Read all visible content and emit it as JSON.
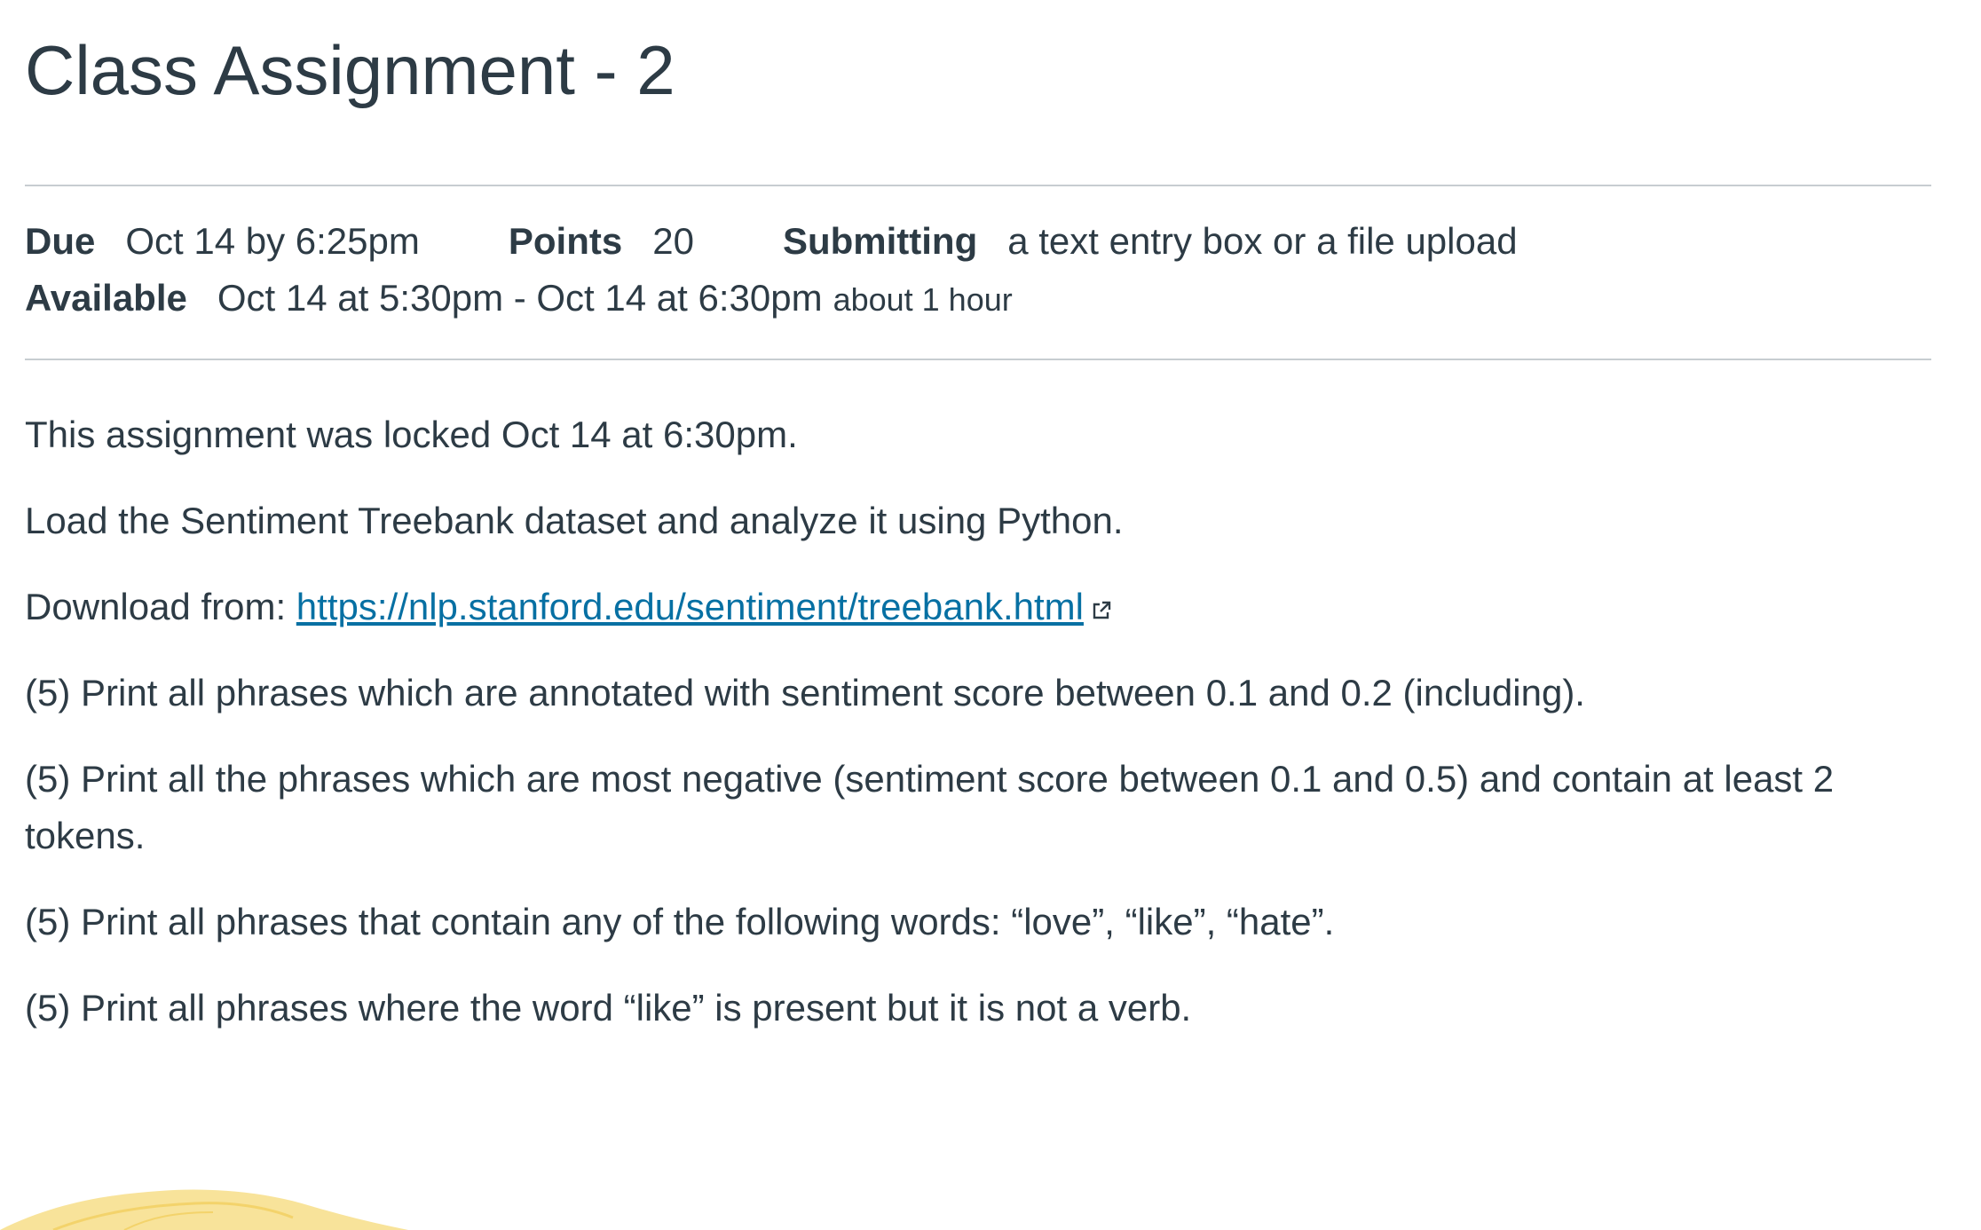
{
  "header": {
    "title": "Class Assignment - 2"
  },
  "details": {
    "due_label": "Due",
    "due_value": "Oct 14 by 6:25pm",
    "points_label": "Points",
    "points_value": "20",
    "submitting_label": "Submitting",
    "submitting_value": "a text entry box or a file upload",
    "available_label": "Available",
    "available_value": "Oct 14 at 5:30pm - Oct 14 at 6:30pm",
    "available_duration": "about 1 hour"
  },
  "content": {
    "locked_notice": "This assignment was locked Oct 14 at 6:30pm.",
    "instruction": "Load the Sentiment Treebank dataset and analyze it using Python.",
    "download_prefix": "Download from: ",
    "download_link_text": "https://nlp.stanford.edu/sentiment/treebank.html",
    "tasks": [
      "(5) Print all phrases which are annotated with  sentiment score between 0.1 and 0.2 (including).",
      "(5) Print all the phrases which are most negative (sentiment score between 0.1 and 0.5) and contain at least 2 tokens.",
      "(5) Print all phrases that contain any of the following words: “love”, “like”, “hate”.",
      "(5) Print all phrases where the word “like” is present but it is not a verb."
    ]
  },
  "icons": {
    "external_link": "external-link-icon",
    "decoration": "footer-decoration"
  },
  "colors": {
    "text": "#2d3b45",
    "link": "#0770a3",
    "divider": "#c7cdd1",
    "decoration": "#f8e39a"
  }
}
